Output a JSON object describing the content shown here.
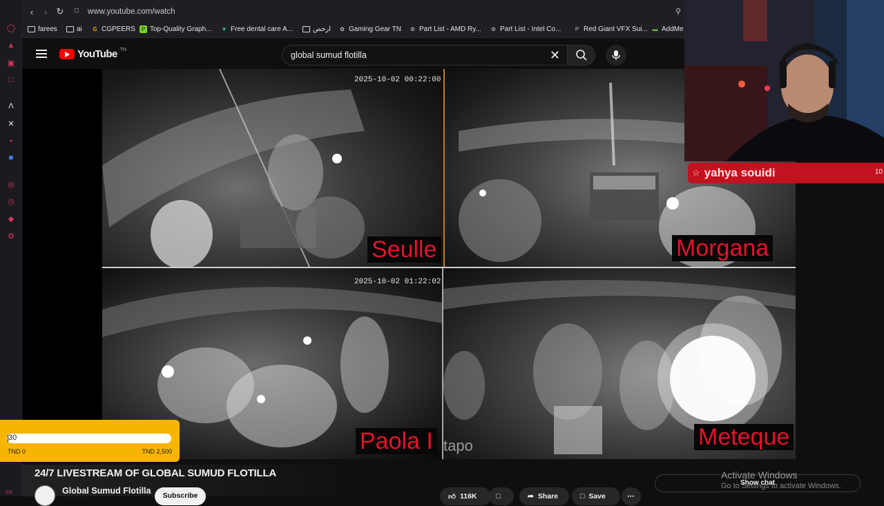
{
  "browser": {
    "url": "www.youtube.com/watch",
    "bookmarks": [
      {
        "label": "farees",
        "icon": "folder-icon"
      },
      {
        "label": "ai",
        "icon": "folder-icon"
      },
      {
        "label": "CGPEERS",
        "icon": "cgpeers-icon"
      },
      {
        "label": "Top-Quality Graph...",
        "icon": "green-site-icon"
      },
      {
        "label": "Free dental care A...",
        "icon": "teal-v-icon"
      },
      {
        "label": "ارخص",
        "icon": "folder-icon"
      },
      {
        "label": "Gaming Gear TN",
        "icon": "gear-site-icon"
      },
      {
        "label": "Part List - AMD Ry...",
        "icon": "pcpartpicker-icon"
      },
      {
        "label": "Part List - Intel Co...",
        "icon": "pcpartpicker-icon"
      },
      {
        "label": "Red Giant VFX Sui...",
        "icon": "p-icon"
      },
      {
        "label": "AddMe",
        "icon": "addme-icon"
      }
    ]
  },
  "youtube": {
    "logo_text": "YouTube",
    "country_code": "TN",
    "search_query": "global sumud flotilla"
  },
  "video": {
    "feeds": [
      {
        "timestamp": "2025-10-02 00:22:00",
        "boat": "Seulle"
      },
      {
        "timestamp": "",
        "boat": "Morgana"
      },
      {
        "timestamp": "2025-10-02 01:22:02",
        "boat": "Paola I"
      },
      {
        "timestamp": "",
        "boat": "Meteque",
        "watermark": "tapo"
      }
    ]
  },
  "streamer": {
    "name": "yahya souidi",
    "badge_count": "10"
  },
  "donation_goal": {
    "value": "30",
    "min_label": "TND 0",
    "max_label": "TND 2,500",
    "progress": 0.012
  },
  "watch": {
    "title": "24/7 LIVESTREAM OF GLOBAL SUMUD FLOTILLA",
    "channel": "Global Sumud Flotilla",
    "subscribe_label": "Subscribe",
    "likes": "116K",
    "share_label": "Share",
    "save_label": "Save",
    "show_chat_label": "Show chat"
  },
  "os_watermark": {
    "line1": "Activate Windows",
    "line2": "Go to Settings to activate Windows."
  },
  "colors": {
    "youtube_red": "#ff0000",
    "goal_yellow": "#f7b500",
    "banner_red": "#c4111f",
    "boat_label_red": "#e5132a"
  }
}
